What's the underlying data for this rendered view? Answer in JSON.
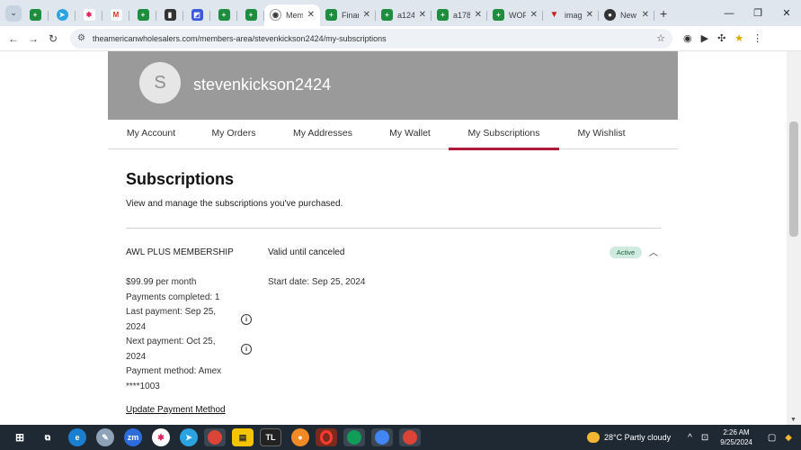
{
  "browser": {
    "tabs": [
      {
        "title": "",
        "icon": "sheets-icon"
      },
      {
        "title": "",
        "icon": "telegram-icon"
      },
      {
        "title": "",
        "icon": "slack-icon"
      },
      {
        "title": "",
        "icon": "gmail-icon"
      },
      {
        "title": "",
        "icon": "sheets-icon"
      },
      {
        "title": "",
        "icon": "dark-app-icon"
      },
      {
        "title": "",
        "icon": "blue-app-icon"
      },
      {
        "title": "",
        "icon": "sheets-icon"
      },
      {
        "title": "",
        "icon": "sheets-icon"
      },
      {
        "title": "Mem",
        "icon": "awl-icon",
        "active": true
      },
      {
        "title": "Finar",
        "icon": "sheets-icon"
      },
      {
        "title": "a124",
        "icon": "sheets-icon"
      },
      {
        "title": "a178",
        "icon": "sheets-icon"
      },
      {
        "title": "WOF",
        "icon": "sheets-icon"
      },
      {
        "title": "imag",
        "icon": "red-triangle-icon"
      },
      {
        "title": "New",
        "icon": "github-icon"
      }
    ],
    "url": "theamericanwholesalers.com/members-area/stevenkickson2424/my-subscriptions"
  },
  "profile": {
    "avatar_initial": "S",
    "username": "stevenkickson2424"
  },
  "account_nav": [
    {
      "label": "My Account",
      "active": false
    },
    {
      "label": "My Orders",
      "active": false
    },
    {
      "label": "My Addresses",
      "active": false
    },
    {
      "label": "My Wallet",
      "active": false
    },
    {
      "label": "My Subscriptions",
      "active": true
    },
    {
      "label": "My Wishlist",
      "active": false
    }
  ],
  "subscriptions": {
    "title": "Subscriptions",
    "subtitle": "View and manage the subscriptions you've purchased.",
    "plan": {
      "name": "AWL PLUS MEMBERSHIP",
      "validity": "Valid until canceled",
      "status": "Active",
      "price": "$99.99 per month",
      "payments_completed": "Payments completed: 1",
      "last_payment_line1": "Last payment: Sep 25,",
      "last_payment_line2": "2024",
      "next_payment_line1": "Next payment: Oct 25,",
      "next_payment_line2": "2024",
      "payment_method_line1": "Payment method: Amex",
      "payment_method_line2": "****1003",
      "start_date": "Start date: Sep 25, 2024",
      "update_link": "Update Payment Method"
    }
  },
  "taskbar": {
    "weather": "28°C  Partly cloudy",
    "time": "2:26 AM",
    "date": "9/25/2024"
  },
  "colors": {
    "banner": "#9a9a9a",
    "active_tab_underline": "#b01a3a",
    "badge_bg": "#cfeadf"
  }
}
